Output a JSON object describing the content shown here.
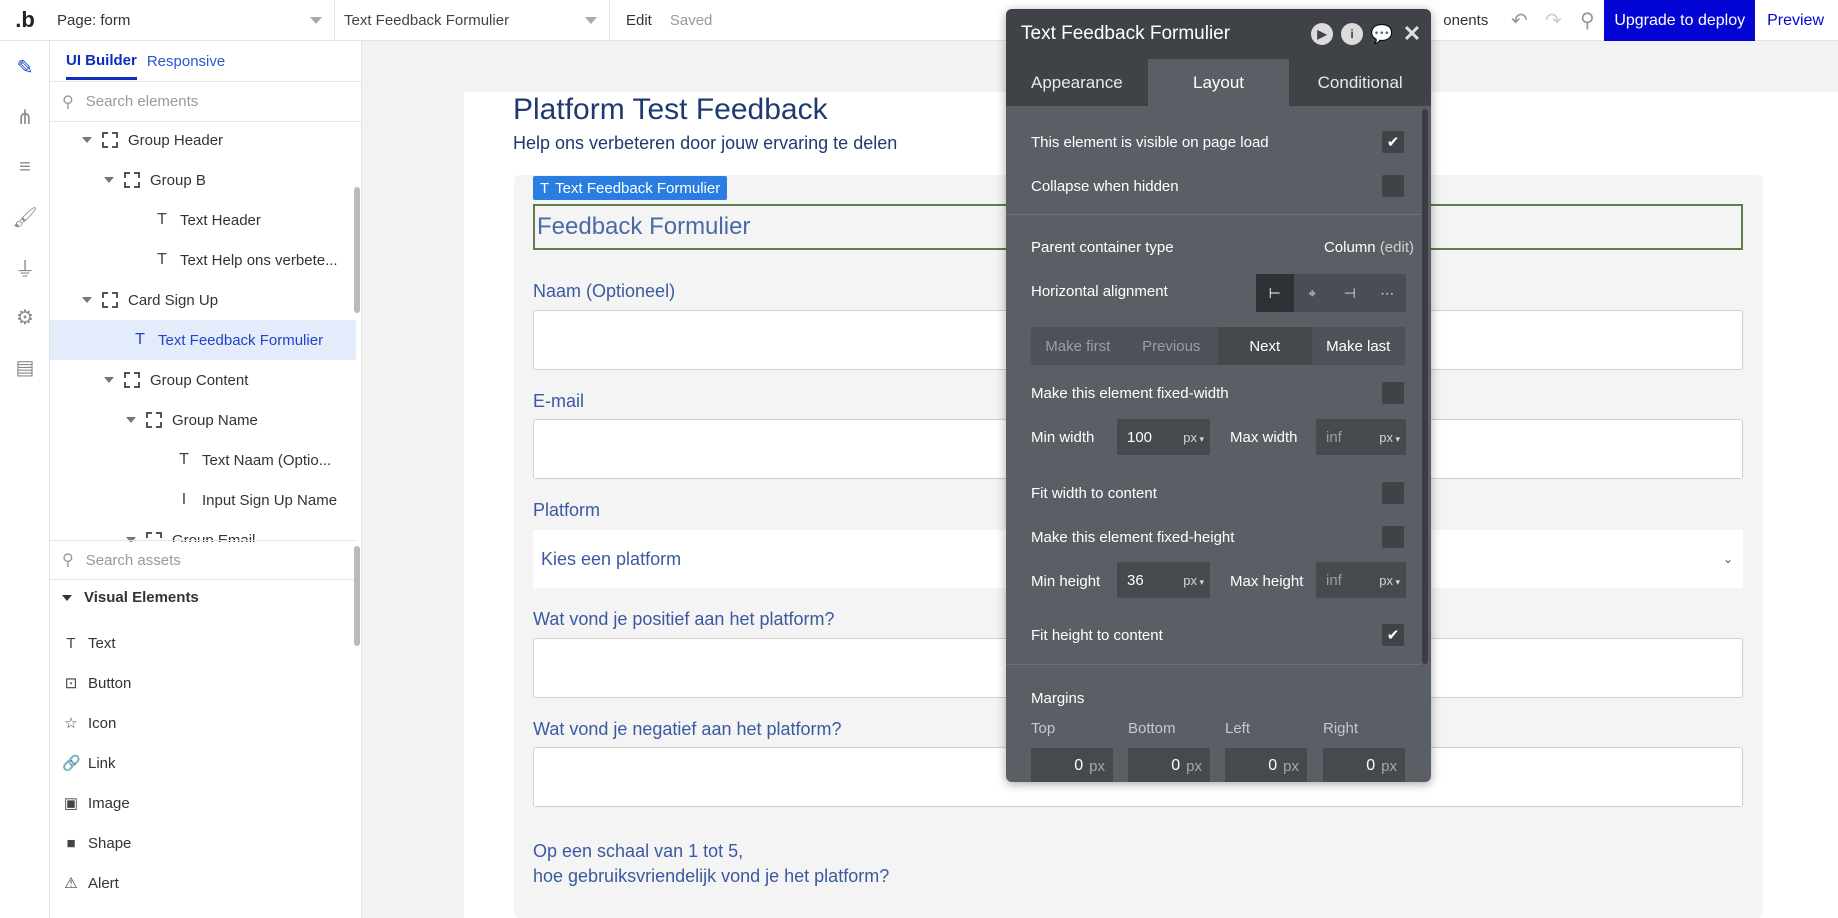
{
  "topbar": {
    "logo": ".b",
    "page_select": "Page: form",
    "element_select": "Text Feedback Formulier",
    "edit": "Edit",
    "saved": "Saved",
    "components": "onents",
    "upgrade": "Upgrade to deploy",
    "preview": "Preview"
  },
  "left": {
    "tabs": [
      "UI Builder",
      "Responsive"
    ],
    "search_elements_placeholder": "Search elements",
    "tree": [
      {
        "label": "Group Header",
        "type": "group",
        "expanded": true
      },
      {
        "label": "Group B",
        "type": "group",
        "expanded": true
      },
      {
        "label": "Text Header",
        "type": "text"
      },
      {
        "label": "Text Help ons verbete...",
        "type": "text"
      },
      {
        "label": "Card Sign Up",
        "type": "group",
        "expanded": true
      },
      {
        "label": "Text Feedback Formulier",
        "type": "text",
        "selected": true
      },
      {
        "label": "Group Content",
        "type": "group",
        "expanded": true
      },
      {
        "label": "Group Name",
        "type": "group",
        "expanded": true
      },
      {
        "label": "Text Naam (Optio...",
        "type": "text"
      },
      {
        "label": "Input Sign Up Name",
        "type": "input"
      },
      {
        "label": "Group Email",
        "type": "group",
        "expanded": true
      }
    ],
    "search_assets_placeholder": "Search assets",
    "visual_elements_header": "Visual Elements",
    "assets": [
      {
        "label": "Text",
        "icon": "T"
      },
      {
        "label": "Button",
        "icon": "⊡"
      },
      {
        "label": "Icon",
        "icon": "☆"
      },
      {
        "label": "Link",
        "icon": "🔗"
      },
      {
        "label": "Image",
        "icon": "▣"
      },
      {
        "label": "Shape",
        "icon": "■"
      },
      {
        "label": "Alert",
        "icon": "⚠"
      }
    ]
  },
  "canvas": {
    "title": "Platform Test Feedback",
    "subtitle": "Help ons verbeteren door jouw ervaring te delen",
    "element_tag": "Text Feedback Formulier",
    "selected_text": "Feedback Formulier",
    "labels": {
      "name": "Naam (Optioneel)",
      "email": "E-mail",
      "platform": "Platform",
      "positive": "Wat vond je positief aan het platform?",
      "negative": "Wat vond je negatief aan het platform?",
      "scale_line1": "Op een schaal van 1 tot 5,",
      "scale_line2": "hoe gebruiksvriendelijk vond je het platform?"
    },
    "platform_placeholder": "Kies een platform"
  },
  "property_editor": {
    "title": "Text Feedback Formulier",
    "tabs": [
      "Appearance",
      "Layout",
      "Conditional"
    ],
    "active_tab": "Layout",
    "visible_on_load": "This element is visible on page load",
    "collapse_when_hidden": "Collapse when hidden",
    "parent_container_type": "Parent container type",
    "container_value": "Column",
    "container_edit": "(edit)",
    "horizontal_alignment": "Horizontal alignment",
    "order_buttons": [
      "Make first",
      "Previous",
      "Next",
      "Make last"
    ],
    "fixed_width": "Make this element fixed-width",
    "min_width_label": "Min width",
    "min_width": "100",
    "max_width_label": "Max width",
    "max_width": "inf",
    "unit": "px",
    "fit_width": "Fit width to content",
    "fixed_height": "Make this element fixed-height",
    "min_height_label": "Min height",
    "min_height": "36",
    "max_height_label": "Max height",
    "max_height": "inf",
    "fit_height": "Fit height to content",
    "margins": "Margins",
    "margin_labels": [
      "Top",
      "Bottom",
      "Left",
      "Right"
    ],
    "margin_values": [
      "0",
      "0",
      "0",
      "0"
    ]
  },
  "colors": {
    "accent": "#0205d3",
    "panel_bg": "#5a5f66",
    "panel_dark": "#3f4348",
    "selection": "#e4ecfc",
    "form_text": "#3a5aa0"
  }
}
